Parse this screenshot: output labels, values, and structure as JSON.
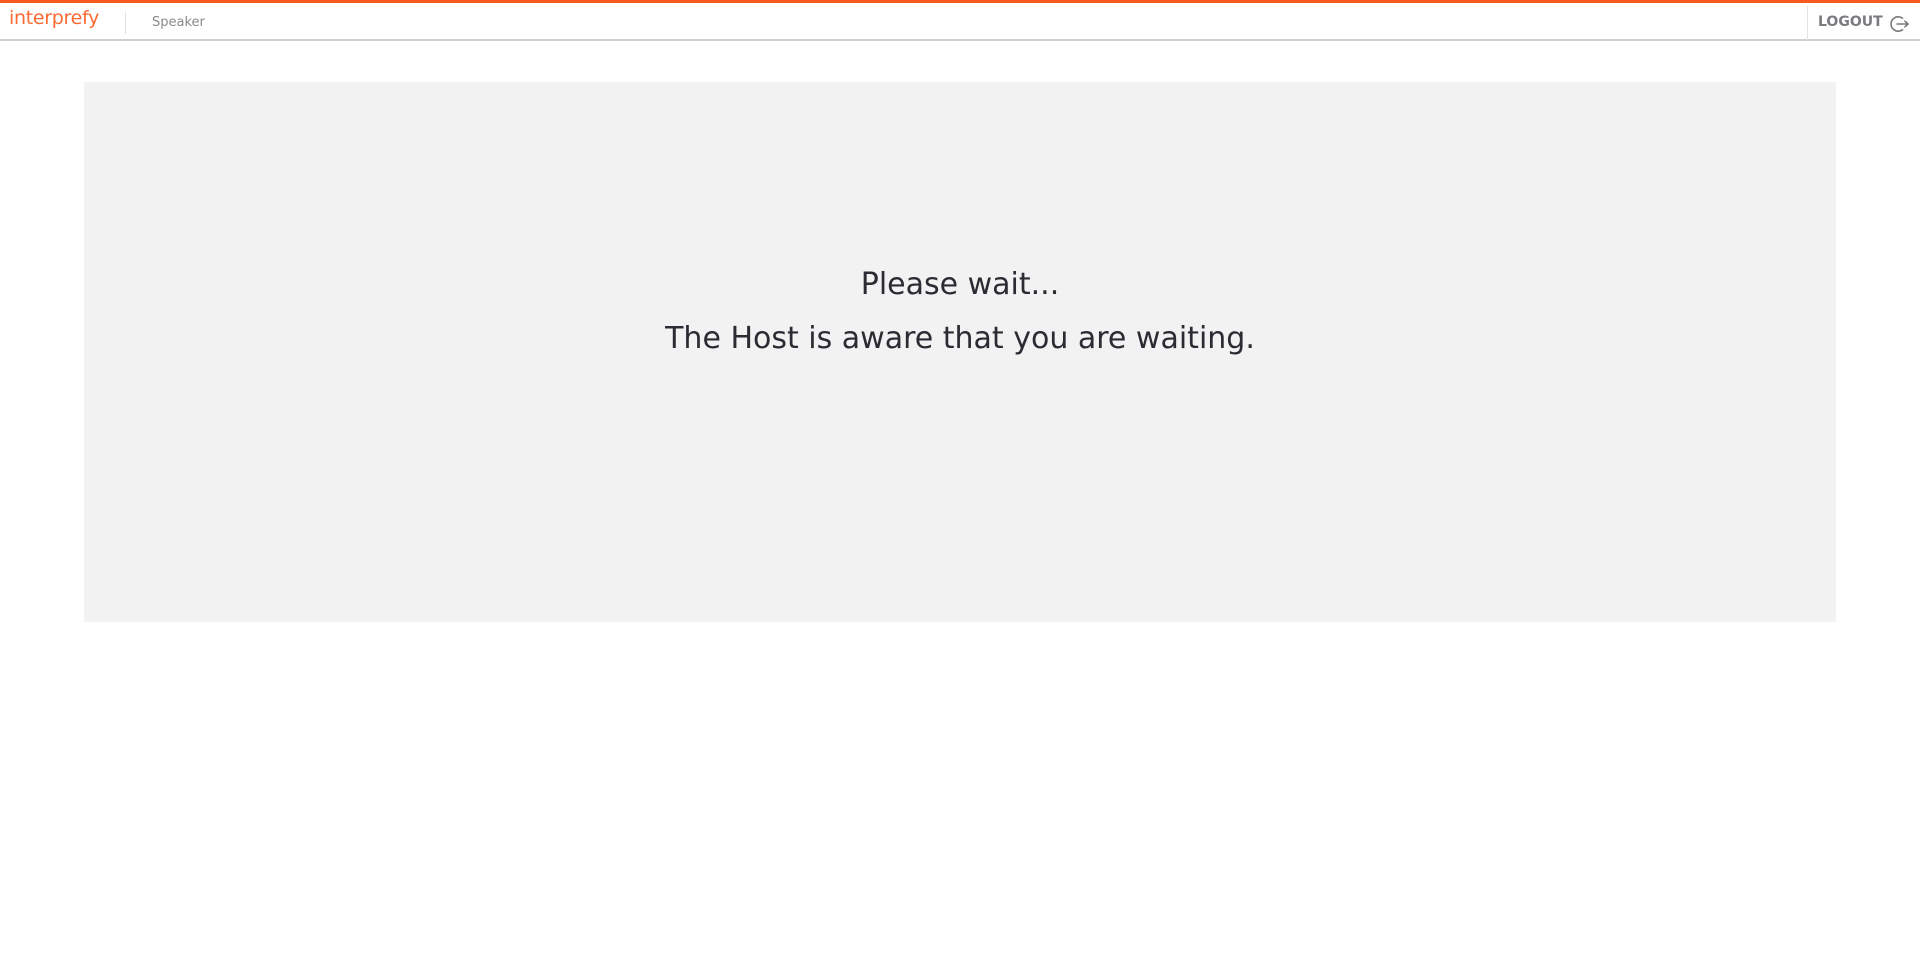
{
  "header": {
    "brand": "interprefy",
    "role_label": "Speaker",
    "logout_label": "LOGOUT",
    "logout_icon": "logout-icon",
    "accent_color": "#fb5a1f"
  },
  "main": {
    "line1": "Please wait...",
    "line2": "The Host is aware that you are waiting.",
    "panel_color": "#f2f2f2"
  }
}
